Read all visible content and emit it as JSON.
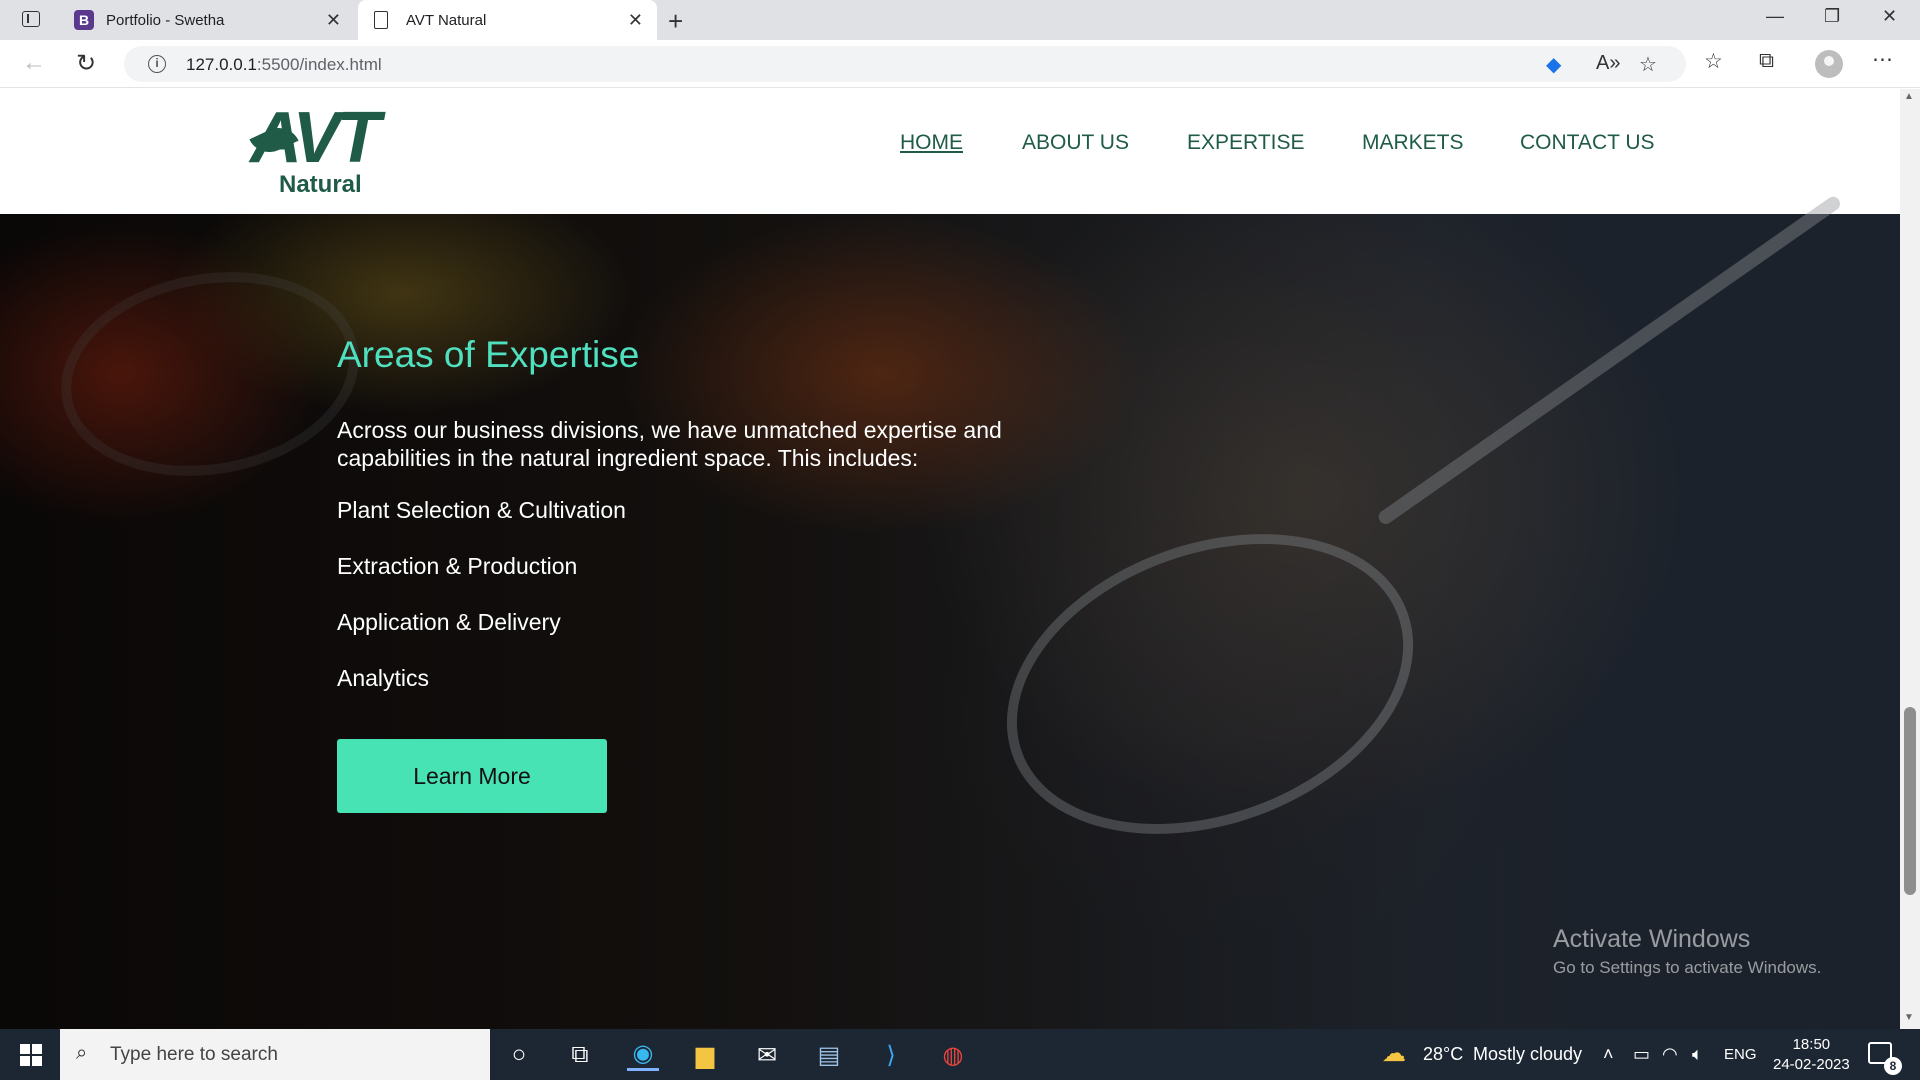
{
  "browser": {
    "tabs": [
      {
        "favicon": "B",
        "title": "Portfolio - Swetha"
      },
      {
        "title": "AVT Natural"
      }
    ],
    "url_host": "127.0.0.1",
    "url_rest": ":5500/index.html",
    "window_controls": {
      "minimize": "—",
      "restore": "❐",
      "close": "✕"
    }
  },
  "site": {
    "logo": {
      "main": "AVT",
      "sub": "Natural"
    },
    "menu": [
      "HOME",
      "ABOUT US",
      "EXPERTISE",
      "MARKETS",
      "CONTACT US"
    ],
    "active_menu": "HOME"
  },
  "hero": {
    "title": "Areas of Expertise",
    "description": "Across our business divisions, we have unmatched expertise and capabilities in the natural ingredient space. This includes:",
    "items": [
      "Plant Selection & Cultivation",
      "Extraction & Production",
      "Application & Delivery",
      "Analytics"
    ],
    "button": "Learn More"
  },
  "watermark": {
    "title": "Activate Windows",
    "subtitle": "Go to Settings to activate Windows."
  },
  "taskbar": {
    "search_placeholder": "Type here to search",
    "weather": {
      "temp": "28°C",
      "desc": "Mostly cloudy"
    },
    "language": "ENG",
    "time": "18:50",
    "date": "24-02-2023",
    "notification_count": "8"
  },
  "colors": {
    "brand_green": "#1f5b46",
    "accent_teal": "#4fe0c0",
    "button_bg": "#48e3b4"
  }
}
